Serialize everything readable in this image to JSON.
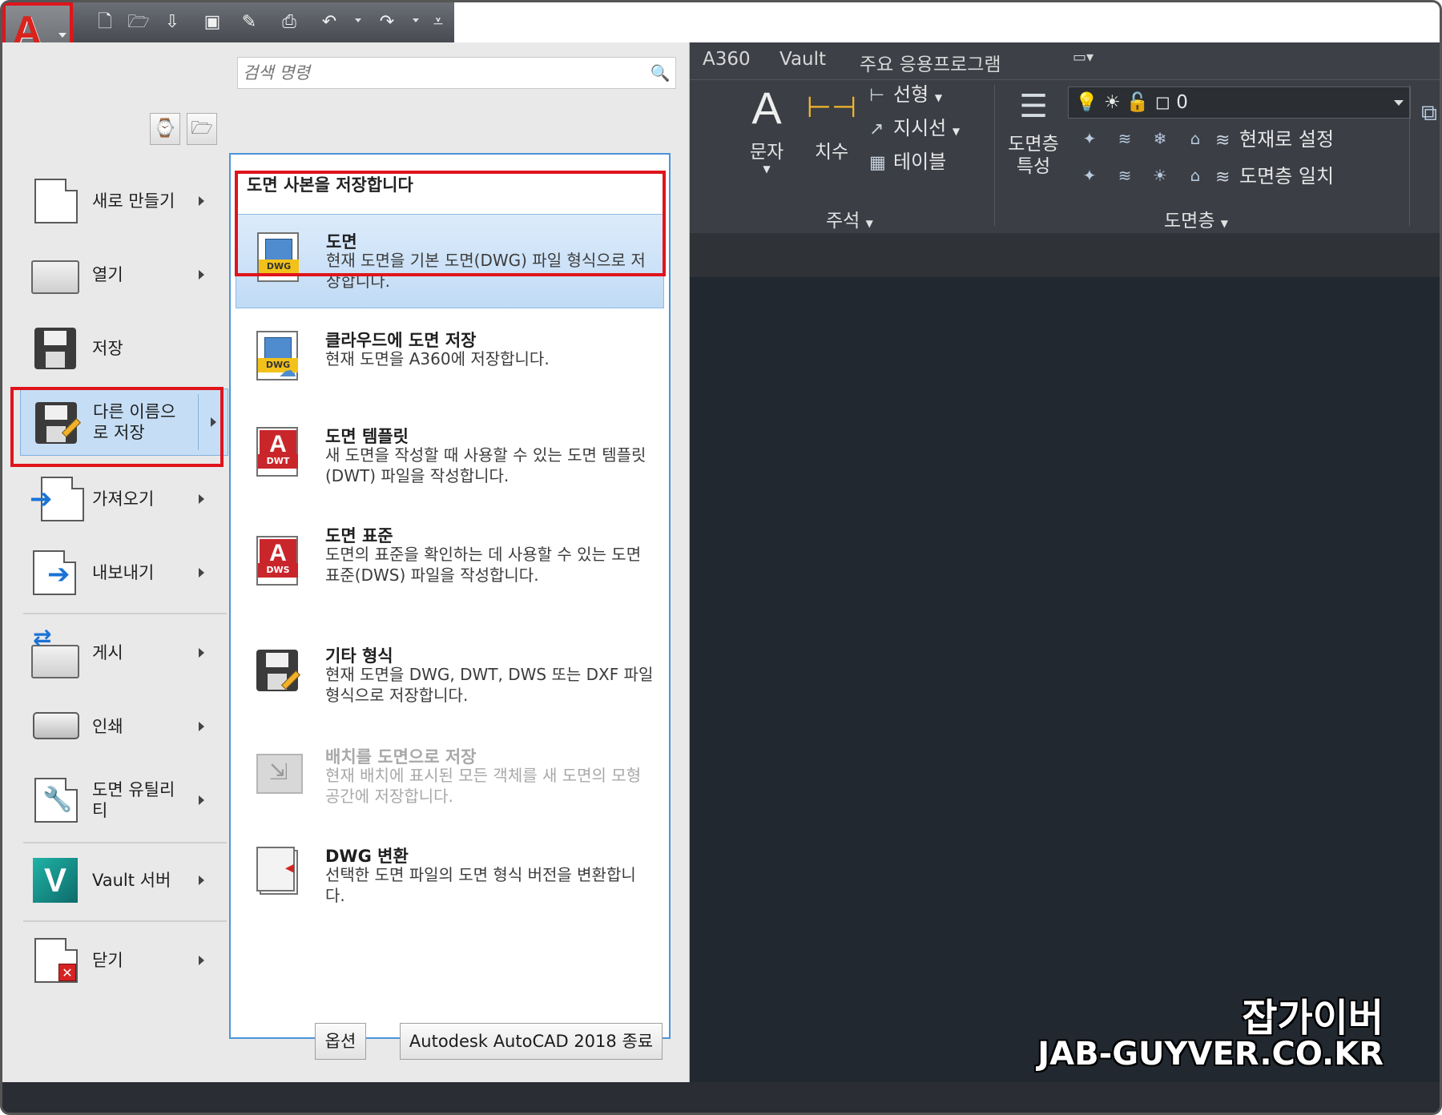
{
  "colors": {
    "highlight": "#e0141b",
    "selection": "#c6def5",
    "ribbon_bg": "#3b3e45",
    "canvas_bg": "#212830",
    "panel_border": "#4c94db"
  },
  "qat": {
    "icons": [
      "new-icon",
      "open-icon",
      "save-to-cloud-icon",
      "save-icon",
      "save-as-icon",
      "plot-icon",
      "undo-icon",
      "redo-icon",
      "customize-icon"
    ]
  },
  "ribbon": {
    "tabs": [
      "A360",
      "Vault",
      "주요 응용프로그램"
    ],
    "annotation": {
      "text_label": "문자",
      "dimension_label": "치수",
      "linear_label": "선형",
      "leader_label": "지시선",
      "table_label": "테이블",
      "panel_title": "주석"
    },
    "layers": {
      "properties_label": "도면층\n특성",
      "combo_value": "0",
      "make_current": "현재로 설정",
      "match": "도면층 일치",
      "panel_title": "도면층"
    }
  },
  "search": {
    "placeholder": "검색 명령"
  },
  "left_menu": [
    {
      "label": "새로 만들기"
    },
    {
      "label": "열기"
    },
    {
      "label": "저장"
    },
    {
      "label": "다른 이름으로 저장"
    },
    {
      "label": "가져오기"
    },
    {
      "label": "내보내기"
    },
    {
      "label": "게시"
    },
    {
      "label": "인쇄"
    },
    {
      "label": "도면 유틸리티"
    },
    {
      "label": "Vault 서버"
    },
    {
      "label": "닫기"
    }
  ],
  "submenu": {
    "title": "도면 사본을 저장합니다",
    "items": [
      {
        "title": "도면",
        "desc": "현재 도면을 기본 도면(DWG) 파일 형식으로 저장합니다.",
        "badge": "DWG"
      },
      {
        "title": "클라우드에 도면 저장",
        "desc": "현재 도면을 A360에 저장합니다.",
        "badge": "DWG"
      },
      {
        "title": "도면 템플릿",
        "desc": "새 도면을 작성할 때 사용할 수 있는 도면 템플릿(DWT) 파일을 작성합니다.",
        "badge": "DWT"
      },
      {
        "title": "도면 표준",
        "desc": "도면의 표준을 확인하는 데 사용할 수 있는 도면 표준(DWS) 파일을 작성합니다.",
        "badge": "DWS"
      },
      {
        "title": "기타 형식",
        "desc": "현재 도면을 DWG, DWT, DWS 또는 DXF 파일 형식으로 저장합니다."
      },
      {
        "title": "배치를 도면으로 저장",
        "desc": "현재 배치에 표시된 모든 객체를 새 도면의 모형 공간에 저장합니다."
      },
      {
        "title": "DWG 변환",
        "desc": "선택한 도면 파일의 도면 형식 버전을 변환합니다."
      }
    ]
  },
  "footer": {
    "options_label": "옵션",
    "exit_label": "Autodesk AutoCAD 2018 종료"
  },
  "watermark": {
    "line1": "잡가이버",
    "line2": "JAB-GUYVER.CO.KR"
  }
}
